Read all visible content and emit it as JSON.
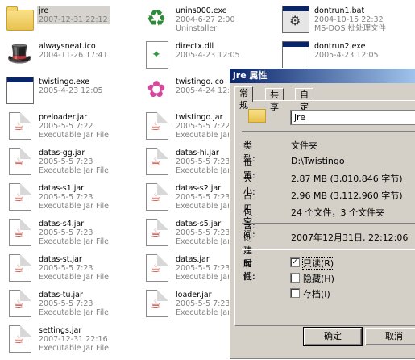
{
  "files": [
    {
      "id": "jre",
      "name": "jre",
      "line2": "2007-12-31 22:12",
      "line3": "",
      "icon": "folder-icon",
      "selected": true
    },
    {
      "id": "unins000",
      "name": "unins000.exe",
      "line2": "2004-6-27 2:00",
      "line3": "Uninstaller",
      "icon": "recycle-icon"
    },
    {
      "id": "dontrun1",
      "name": "dontrun1.bat",
      "line2": "2004-10-15 22:32",
      "line3": "MS-DOS 批处理文件",
      "icon": "batch-file-icon"
    },
    {
      "id": "alwaysneat",
      "name": "alwaysneat.ico",
      "line2": "2004-11-26 17:41",
      "line3": "",
      "icon": "magic-hat-icon"
    },
    {
      "id": "directx",
      "name": "directx.dll",
      "line2": "2005-4-23 12:05",
      "line3": "",
      "icon": "dll-icon"
    },
    {
      "id": "dontrun2",
      "name": "dontrun2.exe",
      "line2": "2005-4-23 12:05",
      "line3": "",
      "icon": "window-app-icon"
    },
    {
      "id": "twistingo-exe",
      "name": "twistingo.exe",
      "line2": "2005-4-23 12:05",
      "line3": "",
      "icon": "window-app-icon"
    },
    {
      "id": "twistingo-ico",
      "name": "twistingo.ico",
      "line2": "2005-4-24 12:10",
      "line3": "",
      "icon": "orchid-icon"
    },
    {
      "id": "preloader",
      "name": "preloader.jar",
      "line2": "2005-5-5 7:22",
      "line3": "Executable Jar File",
      "icon": "jar-icon"
    },
    {
      "id": "twistingo-jar",
      "name": "twistingo.jar",
      "line2": "2005-5-5 7:22",
      "line3": "Executable Jar File",
      "icon": "jar-icon"
    },
    {
      "id": "datas-gg",
      "name": "datas-gg.jar",
      "line2": "2005-5-5 7:23",
      "line3": "Executable Jar File",
      "icon": "jar-icon"
    },
    {
      "id": "datas-hi",
      "name": "datas-hi.jar",
      "line2": "2005-5-5 7:23",
      "line3": "Executable Jar File",
      "icon": "jar-icon"
    },
    {
      "id": "datas-s1",
      "name": "datas-s1.jar",
      "line2": "2005-5-5 7:23",
      "line3": "Executable Jar File",
      "icon": "jar-icon"
    },
    {
      "id": "datas-s2",
      "name": "datas-s2.jar",
      "line2": "2005-5-5 7:23",
      "line3": "Executable Jar File",
      "icon": "jar-icon"
    },
    {
      "id": "datas-s4",
      "name": "datas-s4.jar",
      "line2": "2005-5-5 7:23",
      "line3": "Executable Jar File",
      "icon": "jar-icon"
    },
    {
      "id": "datas-s5",
      "name": "datas-s5.jar",
      "line2": "2005-5-5 7:23",
      "line3": "Executable Jar File",
      "icon": "jar-icon"
    },
    {
      "id": "datas-st",
      "name": "datas-st.jar",
      "line2": "2005-5-5 7:23",
      "line3": "Executable Jar File",
      "icon": "jar-icon"
    },
    {
      "id": "datas",
      "name": "datas.jar",
      "line2": "2005-5-5 7:23",
      "line3": "Executable Jar File",
      "icon": "jar-icon"
    },
    {
      "id": "datas-tu",
      "name": "datas-tu.jar",
      "line2": "2005-5-5 7:23",
      "line3": "Executable Jar File",
      "icon": "jar-icon"
    },
    {
      "id": "loader",
      "name": "loader.jar",
      "line2": "2005-5-5 7:23",
      "line3": "Executable Jar File",
      "icon": "jar-icon"
    },
    {
      "id": "settings",
      "name": "settings.jar",
      "line2": "2007-12-31 22:16",
      "line3": "Executable Jar File",
      "icon": "jar-icon"
    }
  ],
  "dialog": {
    "title": "jre 属性",
    "tabs": [
      "常规",
      "共享",
      "自定义"
    ],
    "folder_name": "jre",
    "rows": {
      "type_label": "类型:",
      "type_value": "文件夹",
      "location_label": "位置:",
      "location_value": "D:\\Twistingo",
      "size_label": "大小:",
      "size_value": "2.87 MB (3,010,846 字节)",
      "disk_label": "占用空间:",
      "disk_value": "2.96 MB (3,112,960 字节)",
      "contains_label": "包含:",
      "contains_value": "24 个文件，3 个文件夹",
      "created_label": "创建时间:",
      "created_value": "2007年12月31日, 22:12:06",
      "attributes_label": "属性:"
    },
    "attributes": [
      {
        "label": "只读(R)",
        "checked": true
      },
      {
        "label": "隐藏(H)",
        "checked": false
      },
      {
        "label": "存档(I)",
        "checked": false
      }
    ],
    "ok_label": "确定",
    "cancel_label": "取消"
  }
}
